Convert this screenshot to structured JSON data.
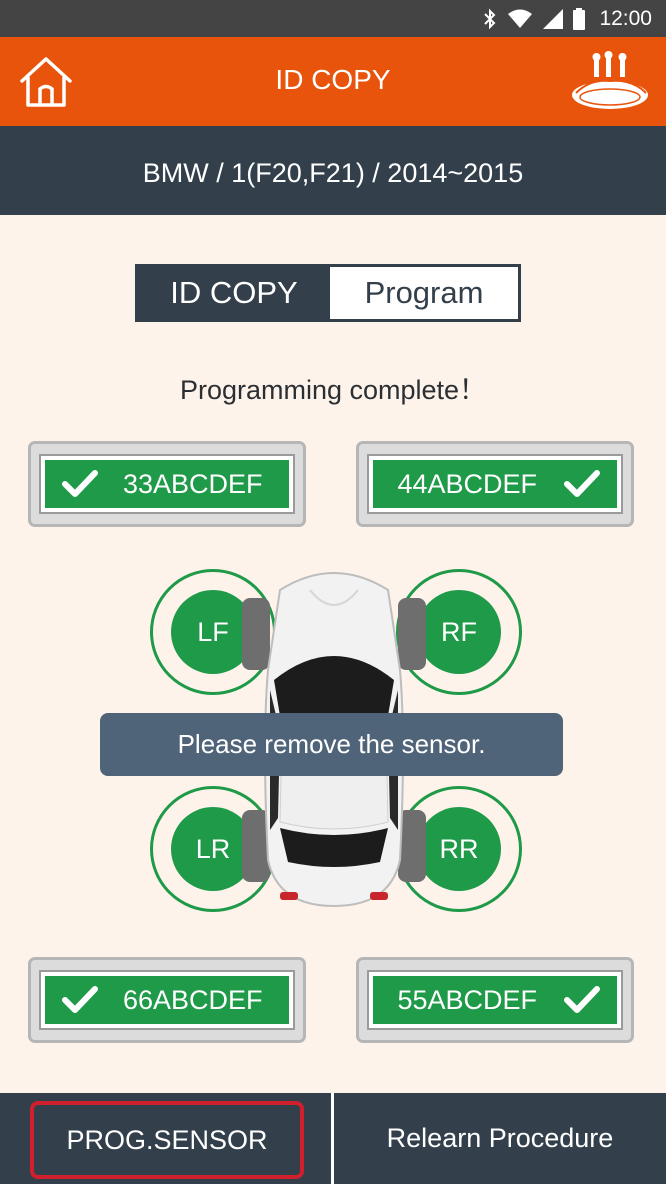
{
  "status_bar": {
    "time": "12:00",
    "icons": [
      "bluetooth-icon",
      "wifi-icon",
      "signal-icon",
      "battery-icon"
    ]
  },
  "app_bar": {
    "title": "ID COPY",
    "home_icon": "home-icon",
    "logo_icon": "car-logo-icon"
  },
  "vehicle": {
    "label": "BMW / 1(F20,F21) / 2014~2015"
  },
  "toggle": {
    "active": "ID COPY",
    "inactive": "Program"
  },
  "message": "Programming complete！",
  "sensors": {
    "lf": {
      "id": "33ABCDEF",
      "status": "check-icon"
    },
    "rf": {
      "id": "44ABCDEF",
      "status": "check-icon"
    },
    "lr": {
      "id": "66ABCDEF",
      "status": "check-icon"
    },
    "rr": {
      "id": "55ABCDEF",
      "status": "check-icon"
    }
  },
  "wheels": {
    "lf": "LF",
    "rf": "RF",
    "lr": "LR",
    "rr": "RR"
  },
  "toast": "Please remove the sensor.",
  "bottom": {
    "prog_sensor": "PROG.SENSOR",
    "relearn": "Relearn Procedure"
  },
  "colors": {
    "accent": "#e8540b",
    "dark": "#33404b",
    "success": "#1e9a48",
    "highlight": "#d0202d",
    "toast": "#4f6479"
  }
}
